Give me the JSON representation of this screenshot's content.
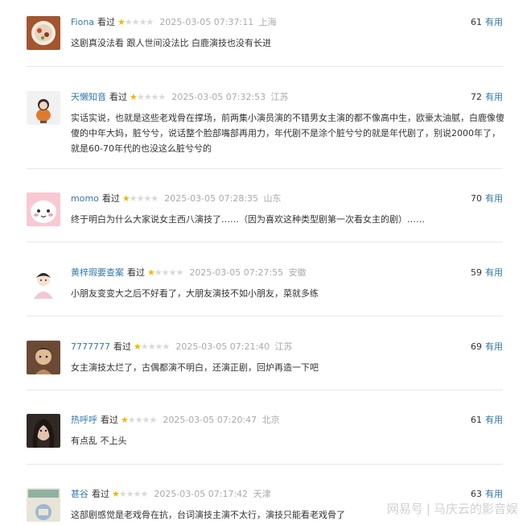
{
  "reviews": [
    {
      "user": "Fiona",
      "watched": "看过",
      "rating": 1,
      "time": "2025-03-05 07:37:11",
      "location": "上海",
      "votes": "61",
      "useful": "有用",
      "content": "这剧真没法看 跟人世间没法比 白鹿演技也没有长进",
      "avatar_colors": [
        "#c44b2a",
        "#f3e4d3"
      ]
    },
    {
      "user": "天懒知音",
      "watched": "看过",
      "rating": 1,
      "time": "2025-03-05 07:32:53",
      "location": "江苏",
      "votes": "72",
      "useful": "有用",
      "content": "实话实说，也就是这些老戏骨在撑场，前两集小演员演的不错男女主演的都不像高中生，欧豪太油腻，白鹿像傻傻的中年大妈，脏兮兮，说话整个脸部嘴部再用力，年代剧不是涂个脏兮兮的就是年代剧了，别说2000年了，就是60-70年代的也没这么脏兮兮的",
      "avatar_colors": [
        "#e07a2f",
        "#f2f2f2"
      ]
    },
    {
      "user": "momo",
      "watched": "看过",
      "rating": 1,
      "time": "2025-03-05 07:28:35",
      "location": "山东",
      "votes": "70",
      "useful": "有用",
      "content": "终于明白为什么大家说女主西八演技了……（因为喜欢这种类型剧第一次看女主的剧）……",
      "avatar_colors": [
        "#f7b6c2",
        "#ffffff"
      ]
    },
    {
      "user": "黄梓瑕要查案",
      "watched": "看过",
      "rating": 1,
      "time": "2025-03-05 07:27:55",
      "location": "安徽",
      "votes": "59",
      "useful": "有用",
      "content": "小朋友变变大之后不好看了，大朋友演技不如小朋友，菜就多练",
      "avatar_colors": [
        "#f0d6e0",
        "#2b2b2b"
      ]
    },
    {
      "user": "7777777",
      "watched": "看过",
      "rating": 1,
      "time": "2025-03-05 07:21:40",
      "location": "江苏",
      "votes": "69",
      "useful": "有用",
      "content": "女主演技太烂了，古偶都演不明白，还演正剧，回炉再造一下吧",
      "avatar_colors": [
        "#5a3a2a",
        "#d9b48f"
      ]
    },
    {
      "user": "热呼呼",
      "watched": "看过",
      "rating": 1,
      "time": "2025-03-05 07:20:47",
      "location": "北京",
      "votes": "61",
      "useful": "有用",
      "content": "有点乱 不上头",
      "avatar_colors": [
        "#3a2f2a",
        "#e3c3b0"
      ]
    },
    {
      "user": "甚谷",
      "watched": "看过",
      "rating": 1,
      "time": "2025-03-05 07:17:42",
      "location": "天津",
      "votes": "63",
      "useful": "有用",
      "content": "这部剧感觉是老戏骨在抗，台词演技主演不太行，演技只能看老戏骨了",
      "avatar_colors": [
        "#9fb8a8",
        "#e8e4d8"
      ]
    }
  ],
  "watermark": {
    "brand": "网易号",
    "separator": "|",
    "author": "马庆云的影音娱"
  }
}
